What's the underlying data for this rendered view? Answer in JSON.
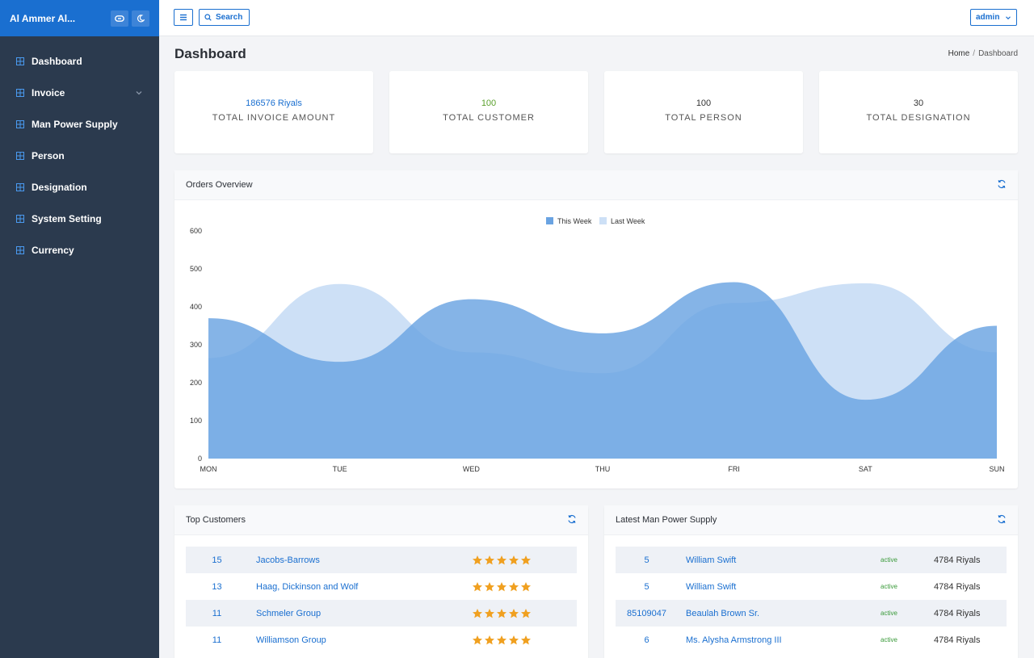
{
  "app": {
    "title": "Al Ammer Al..."
  },
  "sidebar": {
    "items": [
      {
        "label": "Dashboard"
      },
      {
        "label": "Invoice"
      },
      {
        "label": "Man Power Supply"
      },
      {
        "label": "Person"
      },
      {
        "label": "Designation"
      },
      {
        "label": "System Setting"
      },
      {
        "label": "Currency"
      }
    ]
  },
  "topbar": {
    "search_label": "Search",
    "user_label": "admin"
  },
  "page": {
    "title": "Dashboard",
    "breadcrumb": {
      "home": "Home",
      "separator": "/",
      "current": "Dashboard"
    }
  },
  "stats": [
    {
      "value": "186576 Riyals",
      "label": "TOTAL INVOICE AMOUNT",
      "color": "#1a6fd0"
    },
    {
      "value": "100",
      "label": "TOTAL CUSTOMER",
      "color": "#5aa02c"
    },
    {
      "value": "100",
      "label": "TOTAL PERSON",
      "color": "#333333"
    },
    {
      "value": "30",
      "label": "TOTAL DESIGNATION",
      "color": "#333333"
    }
  ],
  "orders_panel": {
    "title": "Orders Overview"
  },
  "chart_data": {
    "type": "area",
    "categories": [
      "MON",
      "TUE",
      "WED",
      "THU",
      "FRI",
      "SAT",
      "SUN"
    ],
    "series": [
      {
        "name": "This Week",
        "values": [
          370,
          255,
          420,
          330,
          465,
          155,
          350
        ],
        "color": "#6aa3e2"
      },
      {
        "name": "Last Week",
        "values": [
          265,
          460,
          280,
          225,
          410,
          462,
          280
        ],
        "color": "#cde0f6"
      }
    ],
    "ylim": [
      0,
      600
    ],
    "yticks": [
      "0",
      "100",
      "200",
      "300",
      "400",
      "500",
      "600"
    ],
    "legend": "top-center",
    "grid": false
  },
  "top_customers": {
    "title": "Top Customers",
    "rows": [
      {
        "id": "15",
        "name": "Jacobs-Barrows",
        "rating": 5
      },
      {
        "id": "13",
        "name": "Haag, Dickinson and Wolf",
        "rating": 5
      },
      {
        "id": "11",
        "name": "Schmeler Group",
        "rating": 5
      },
      {
        "id": "11",
        "name": "Williamson Group",
        "rating": 5
      }
    ]
  },
  "latest_supply": {
    "title": "Latest Man Power Supply",
    "rows": [
      {
        "id": "5",
        "name": "William Swift",
        "status": "active",
        "amount": "4784 Riyals"
      },
      {
        "id": "5",
        "name": "William Swift",
        "status": "active",
        "amount": "4784 Riyals"
      },
      {
        "id": "85109047",
        "name": "Beaulah Brown Sr.",
        "status": "active",
        "amount": "4784 Riyals"
      },
      {
        "id": "6",
        "name": "Ms. Alysha Armstrong III",
        "status": "active",
        "amount": "4784 Riyals"
      }
    ]
  },
  "colors": {
    "accent": "#1a6fd0",
    "sidebar": "#2b3a4e",
    "star": "#f0a020"
  }
}
